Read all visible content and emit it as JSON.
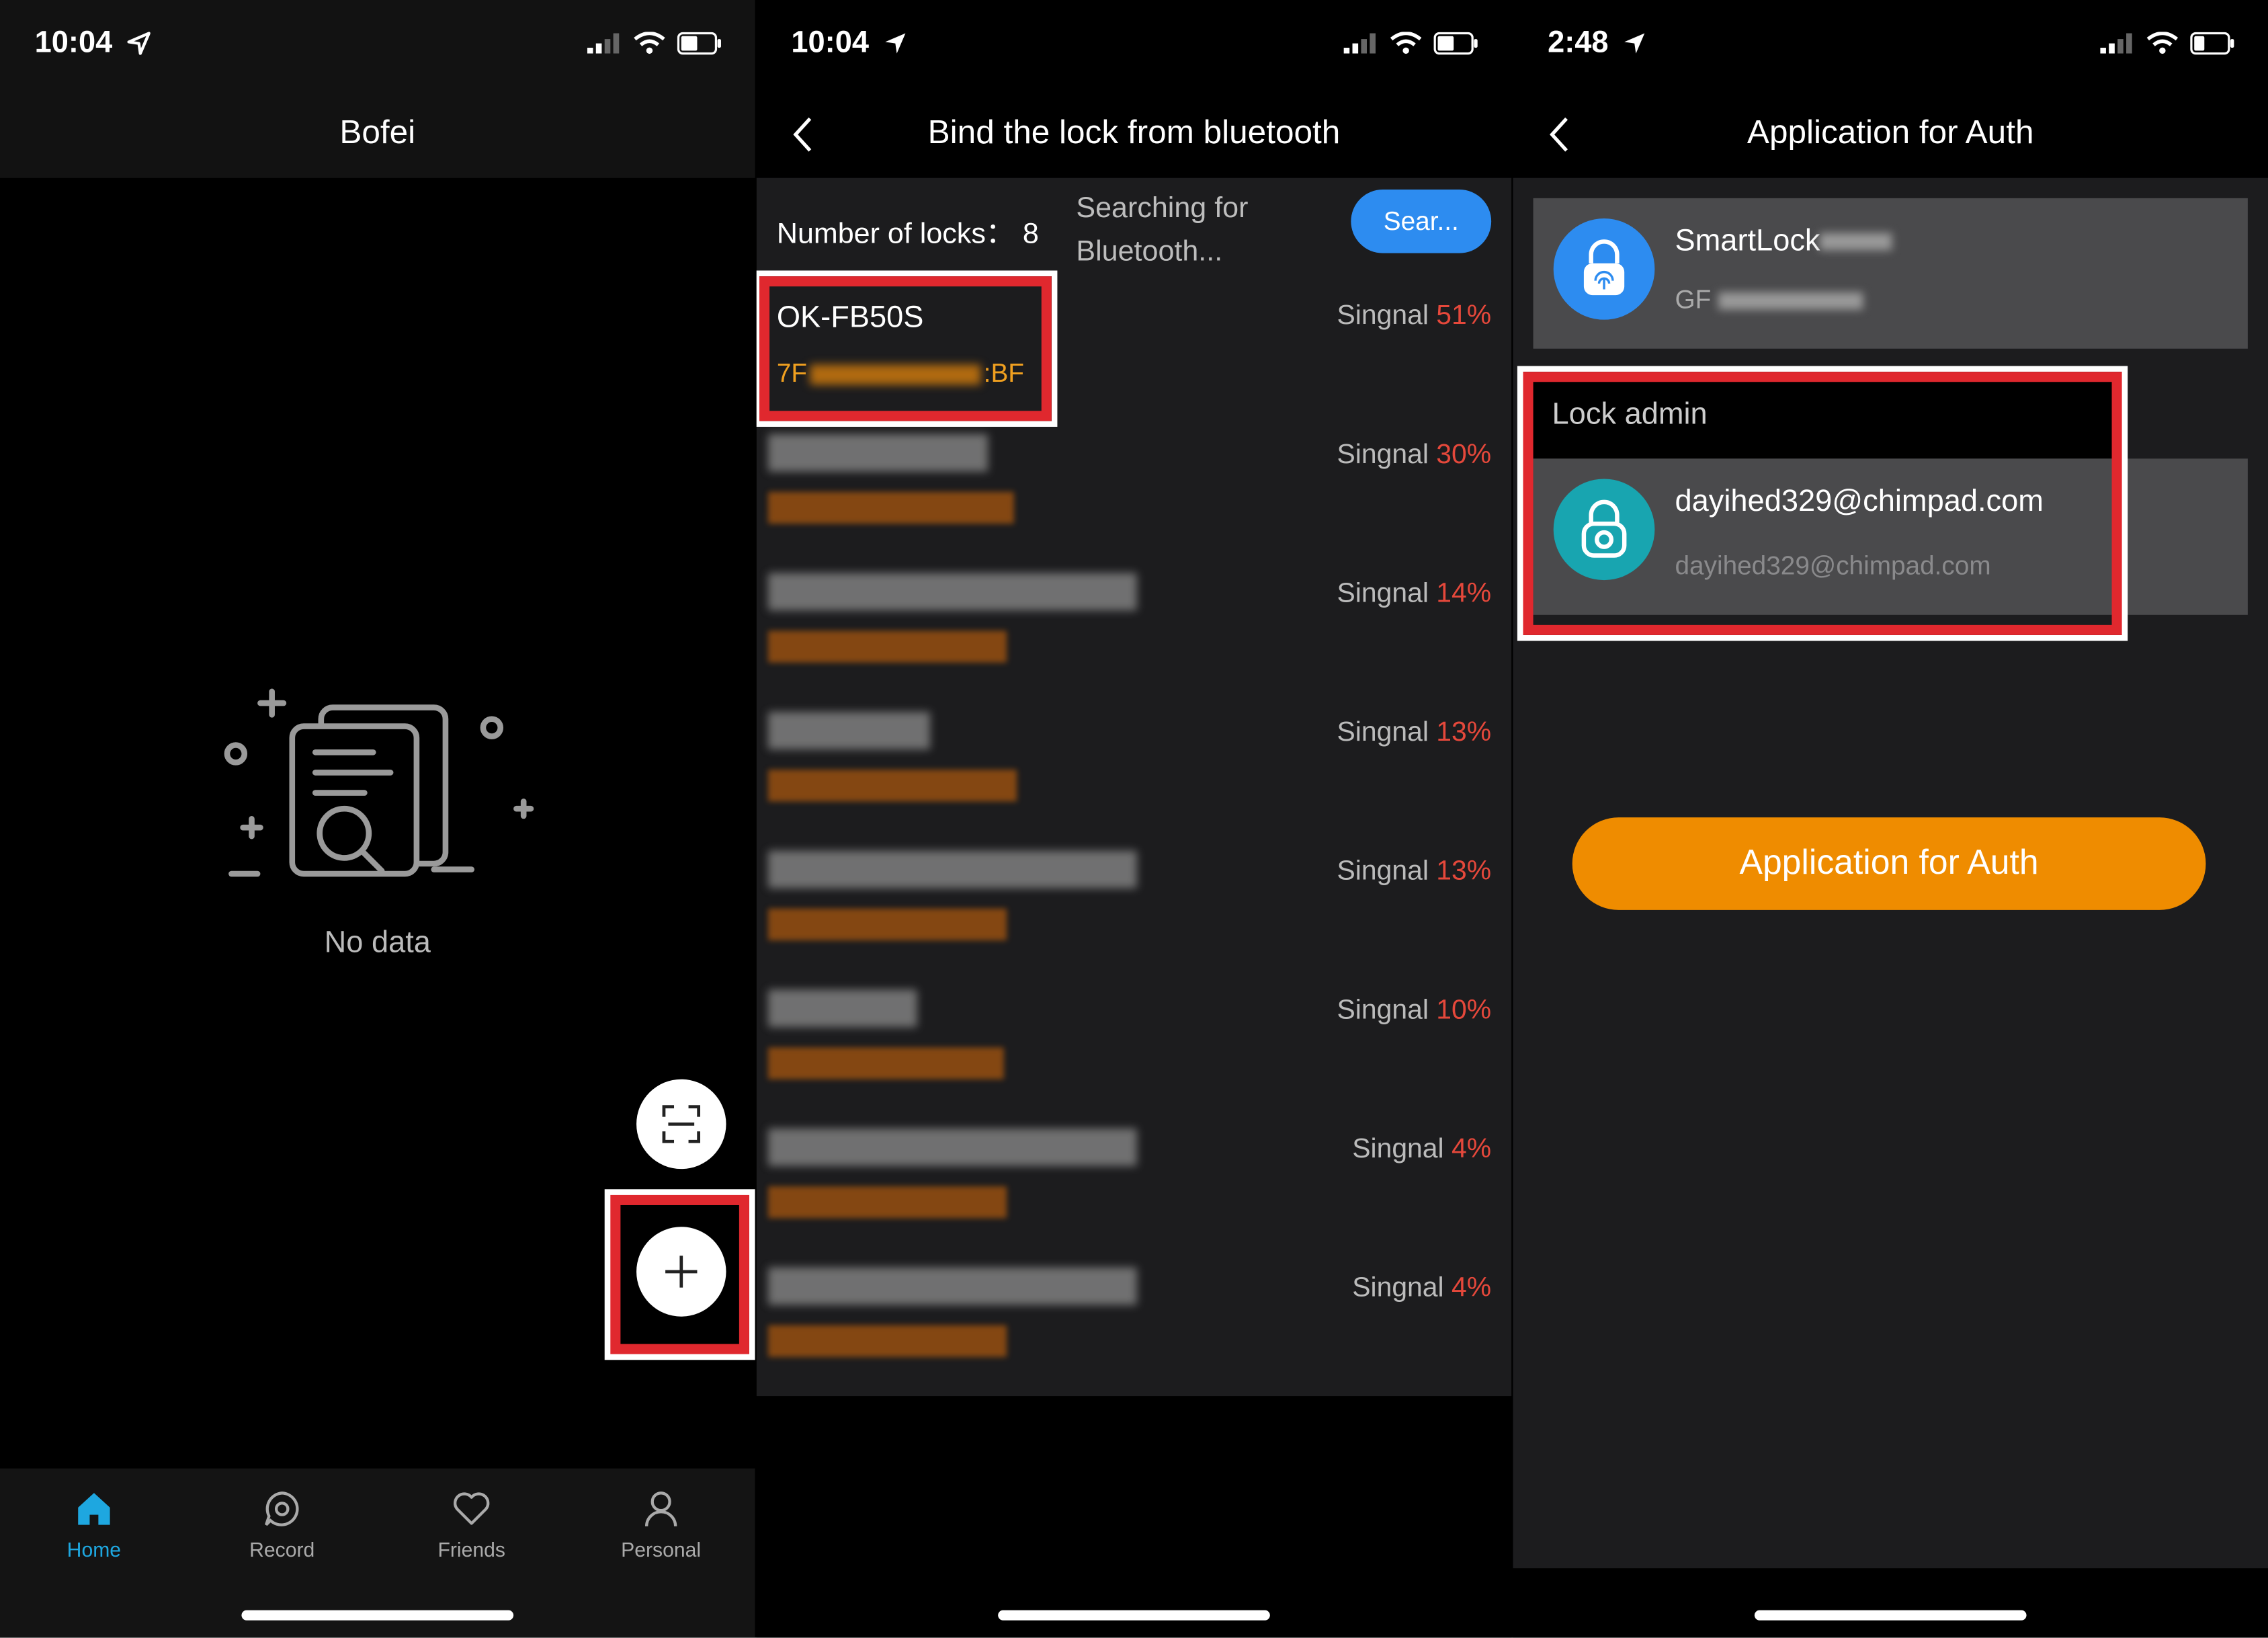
{
  "colors": {
    "accent_blue": "#2d8cf0",
    "tab_active": "#1ea7e0",
    "signal_red": "#e5483b",
    "mac_orange": "#f0a020",
    "cta_orange": "#ef8c00",
    "highlight_red": "#e0282e"
  },
  "screen1": {
    "status_time": "10:04",
    "title": "Bofei",
    "empty_text": "No data",
    "tabs": [
      {
        "label": "Home",
        "icon": "home-icon",
        "active": true
      },
      {
        "label": "Record",
        "icon": "record-icon",
        "active": false
      },
      {
        "label": "Friends",
        "icon": "heart-icon",
        "active": false
      },
      {
        "label": "Personal",
        "icon": "person-icon",
        "active": false
      }
    ]
  },
  "screen2": {
    "status_time": "10:04",
    "title": "Bind the lock from bluetooth",
    "lock_count": "Number of locks： 8",
    "searching_text": "Searching for Bluetooth...",
    "search_button": "Sear...",
    "signal_label": "Singnal",
    "first_lock": {
      "name": "OK-FB50S",
      "mac_prefix": "7F",
      "mac_suffix": ":BF"
    },
    "rows": [
      {
        "signal": "51%"
      },
      {
        "signal": "30%"
      },
      {
        "signal": "14%"
      },
      {
        "signal": "13%"
      },
      {
        "signal": "13%"
      },
      {
        "signal": "10%"
      },
      {
        "signal": "4%"
      },
      {
        "signal": "4%"
      }
    ]
  },
  "screen3": {
    "status_time": "2:48",
    "title": "Application for Auth",
    "lock_name": "SmartLock",
    "lock_sub": "GF",
    "section_label": "Lock admin",
    "admin_name": "dayihed329@chimpad.com",
    "admin_sub": "dayihed329@chimpad.com",
    "cta_label": "Application for Auth"
  }
}
